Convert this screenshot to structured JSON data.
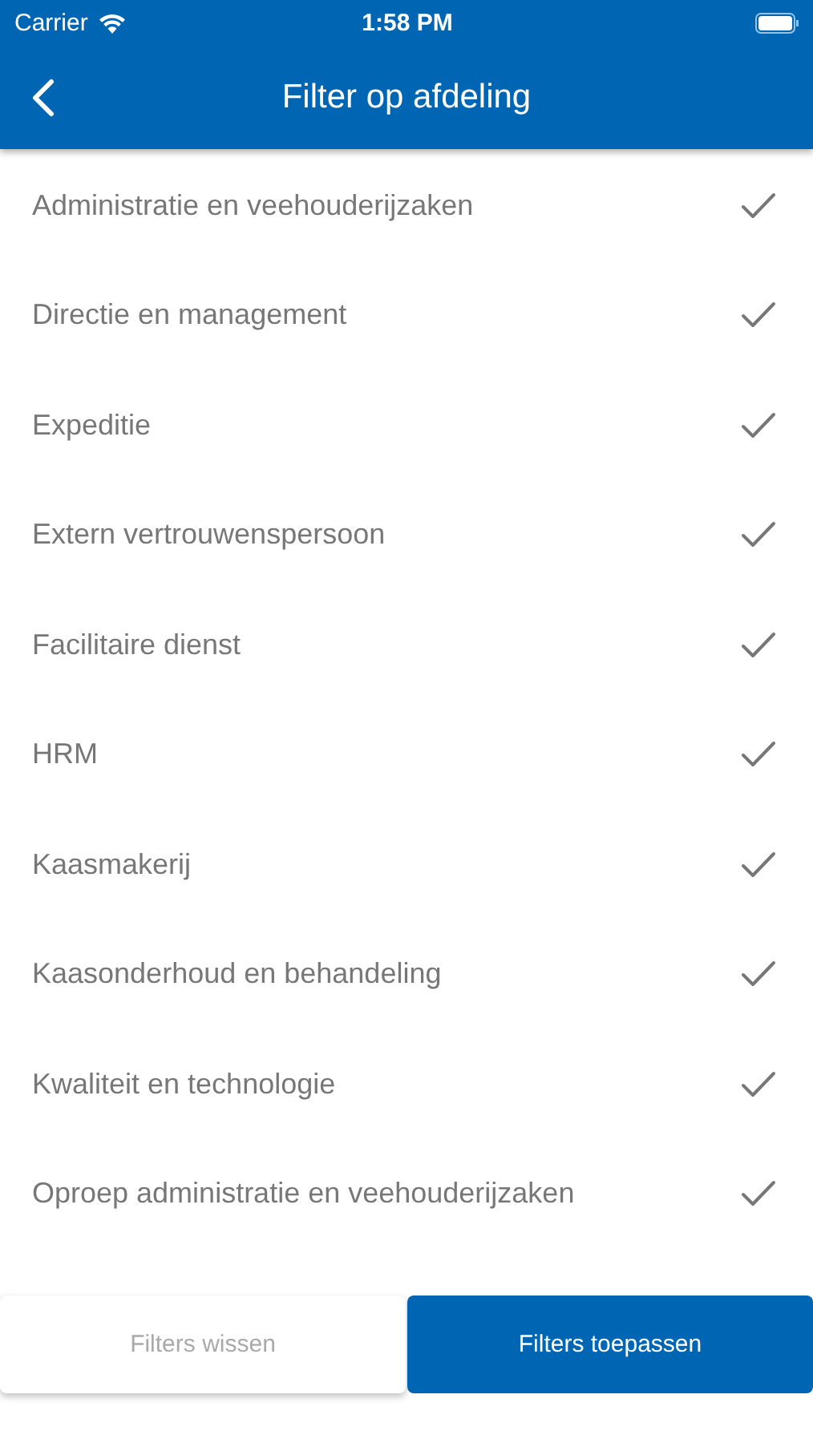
{
  "status_bar": {
    "carrier": "Carrier",
    "time": "1:58 PM"
  },
  "nav_bar": {
    "title": "Filter op afdeling"
  },
  "departments": [
    {
      "label": "Administratie en veehouderijzaken",
      "checked": true
    },
    {
      "label": "Directie en management",
      "checked": true
    },
    {
      "label": "Expeditie",
      "checked": true
    },
    {
      "label": "Extern vertrouwenspersoon",
      "checked": true
    },
    {
      "label": "Facilitaire dienst",
      "checked": true
    },
    {
      "label": "HRM",
      "checked": true
    },
    {
      "label": "Kaasmakerij",
      "checked": true
    },
    {
      "label": "Kaasonderhoud en behandeling",
      "checked": true
    },
    {
      "label": "Kwaliteit en technologie",
      "checked": true
    },
    {
      "label": "Oproep administratie en veehouderijzaken",
      "checked": true
    }
  ],
  "buttons": [
    {
      "label": "Filters wissen",
      "kind": "secondary"
    },
    {
      "label": "Filters toepassen",
      "kind": "primary"
    }
  ]
}
